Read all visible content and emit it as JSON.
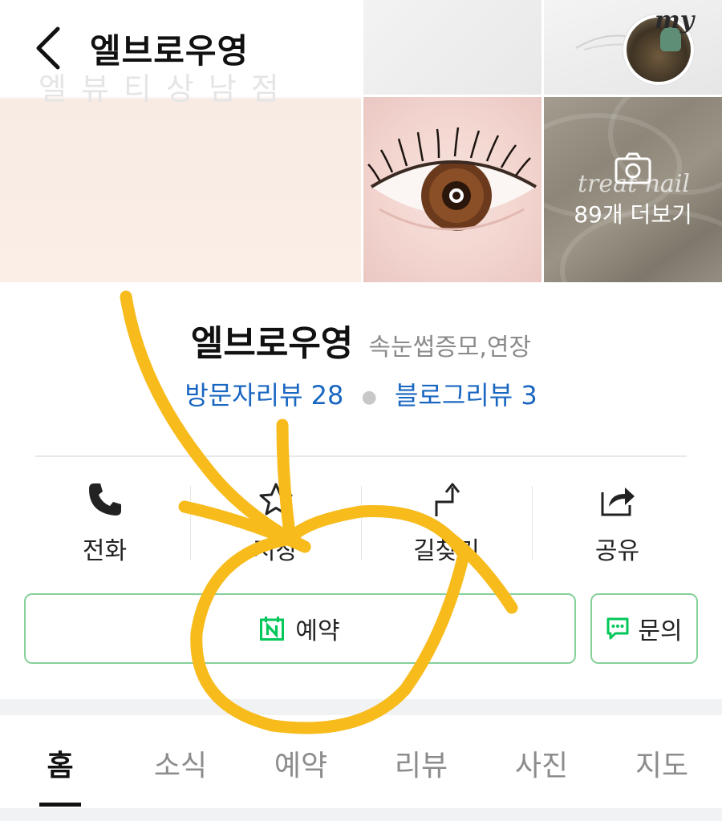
{
  "header": {
    "title": "엘브로우영",
    "subtitle_watermark": "엘뷰티상남점",
    "my_label": "my"
  },
  "photos": {
    "overlay_watermark": "treat nail",
    "more_label": "89개 더보기"
  },
  "shop": {
    "name": "엘브로우영",
    "category": "속눈썹증모,연장",
    "visitor_reviews": "방문자리뷰 28",
    "blog_reviews": "블로그리뷰 3"
  },
  "actions": [
    {
      "label": "전화",
      "icon": "phone-icon"
    },
    {
      "label": "저장",
      "icon": "star-icon"
    },
    {
      "label": "길찾기",
      "icon": "directions-icon"
    },
    {
      "label": "공유",
      "icon": "share-icon"
    }
  ],
  "buttons": {
    "reserve_label": "예약",
    "inquiry_label": "문의"
  },
  "tabs": [
    "홈",
    "소식",
    "예약",
    "리뷰",
    "사진",
    "지도"
  ],
  "colors": {
    "accent_green": "#03c75a",
    "link_blue": "#1a67c2",
    "annotation_yellow": "#f7bb1c"
  }
}
